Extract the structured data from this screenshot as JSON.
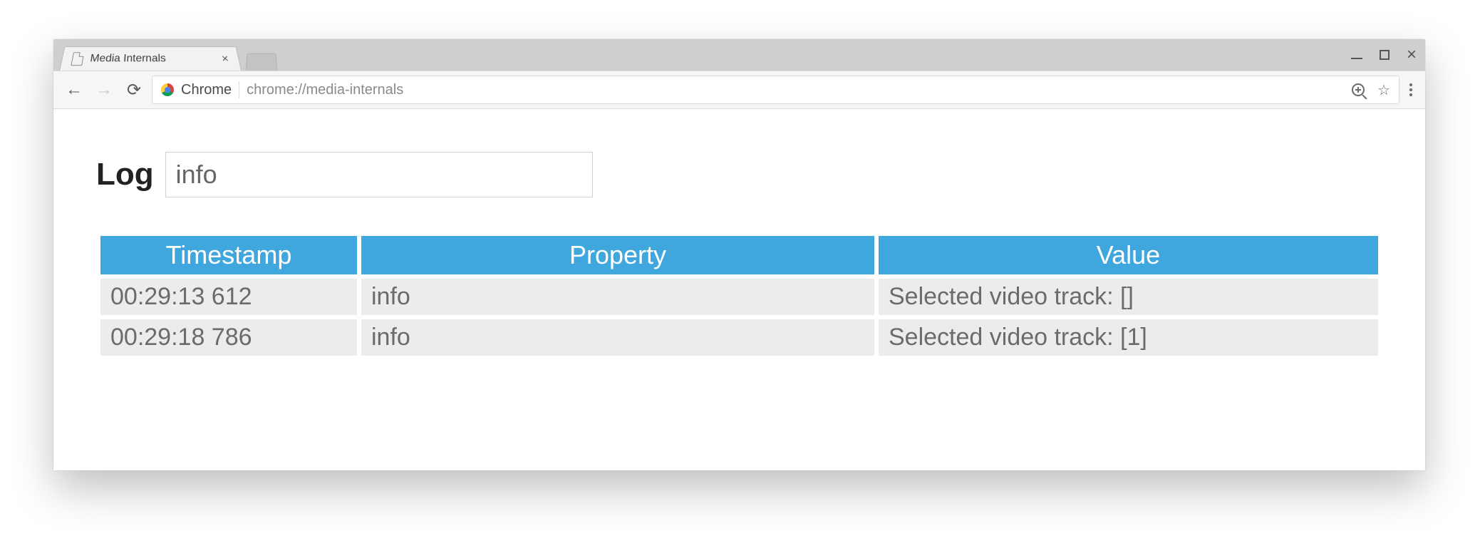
{
  "window": {
    "tab_title": "Media Internals"
  },
  "toolbar": {
    "origin_label": "Chrome",
    "url": "chrome://media-internals"
  },
  "log": {
    "title": "Log",
    "filter_value": "info",
    "columns": {
      "timestamp": "Timestamp",
      "property": "Property",
      "value": "Value"
    },
    "rows": [
      {
        "timestamp": "00:29:13 612",
        "property": "info",
        "value": "Selected video track: []"
      },
      {
        "timestamp": "00:29:18 786",
        "property": "info",
        "value": "Selected video track: [1]"
      }
    ]
  }
}
